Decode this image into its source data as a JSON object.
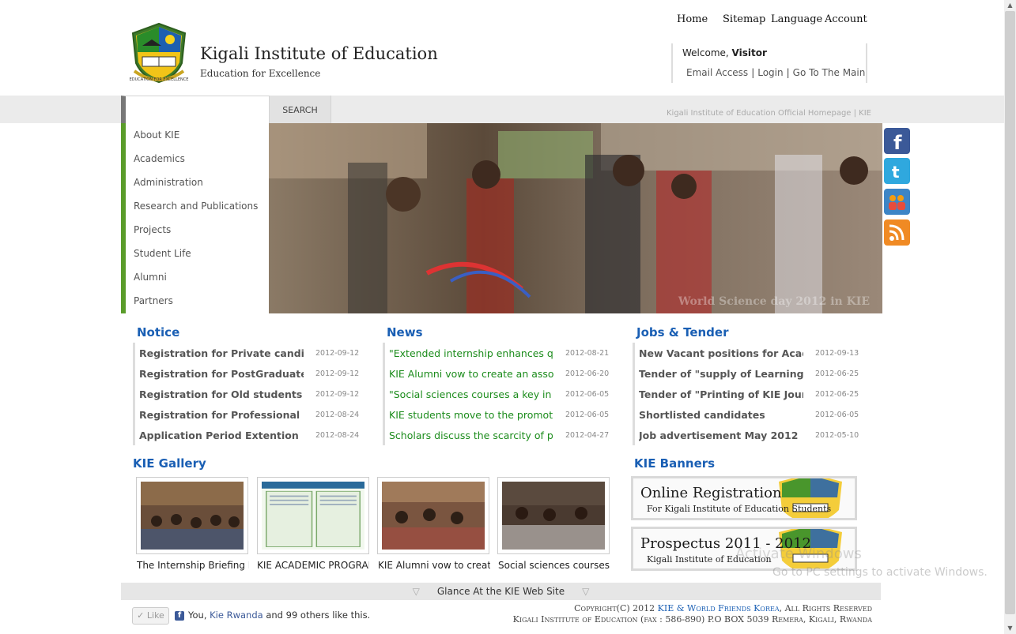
{
  "header": {
    "title": "Kigali Institute of Education",
    "tagline": "Education for Excellence",
    "logo_motto": "EDUCATION FOR EXCELLENCE"
  },
  "topnav": [
    "Home",
    "Sitemap",
    "Language",
    "Account"
  ],
  "welcome": {
    "prefix": "Welcome, ",
    "user": "Visitor",
    "links": [
      "Email Access",
      "Login",
      "Go To The Main"
    ]
  },
  "search": {
    "placeholder": "",
    "button": "SEARCH"
  },
  "breadcrumb": "Kigali Institute of Education Official Homepage | KIE",
  "leftnav": [
    "About KIE",
    "Academics",
    "Administration",
    "Research and Publications",
    "Projects",
    "Student Life",
    "Alumni",
    "Partners"
  ],
  "hero": {
    "caption": "World Science day 2012 in KIE"
  },
  "social": [
    "facebook-icon",
    "twitter-icon",
    "myspace-icon",
    "rss-icon"
  ],
  "notice": {
    "title": "Notice",
    "items": [
      {
        "title": "Registration for Private candidate",
        "date": "2012-09-12"
      },
      {
        "title": "Registration for PostGraduate & I",
        "date": "2012-09-12"
      },
      {
        "title": "Registration for Old students (Da",
        "date": "2012-09-12"
      },
      {
        "title": "Registration for Professional Polic",
        "date": "2012-08-24"
      },
      {
        "title": "Application Period Extention",
        "date": "2012-08-24"
      }
    ]
  },
  "news": {
    "title": "News",
    "items": [
      {
        "title": "\"Extended internship enhances quality",
        "date": "2012-08-21"
      },
      {
        "title": "KIE Alumni vow to create an associati",
        "date": "2012-06-20"
      },
      {
        "title": "\"Social sciences courses a key in Socia",
        "date": "2012-06-05"
      },
      {
        "title": "KIE students move to the promotion c",
        "date": "2012-06-05"
      },
      {
        "title": "Scholars discuss the scarcity of profes",
        "date": "2012-04-27"
      }
    ]
  },
  "jobs": {
    "title": "Jobs & Tender",
    "items": [
      {
        "title": "New Vacant positions for Academ",
        "date": "2012-09-13"
      },
      {
        "title": "Tender of \"supply of Learning/Te",
        "date": "2012-06-25"
      },
      {
        "title": "Tender of \"Printing of KIE Journa",
        "date": "2012-06-25"
      },
      {
        "title": "Shortlisted candidates",
        "date": "2012-06-05"
      },
      {
        "title": "Job advertisement May 2012",
        "date": "2012-05-10"
      }
    ]
  },
  "gallery": {
    "title": "KIE Gallery",
    "items": [
      {
        "caption": "The Internship Briefing Me"
      },
      {
        "caption": "KIE ACADEMIC PROGRAM"
      },
      {
        "caption": "KIE Alumni vow to create"
      },
      {
        "caption": "Social sciences courses a k"
      }
    ]
  },
  "banners": {
    "title": "KIE Banners",
    "items": [
      {
        "line1": "Online Registration",
        "line2": "For Kigali Institute of Education Students"
      },
      {
        "line1": "Prospectus 2011 - 2012",
        "line2": "Kigali Institute of Education"
      }
    ]
  },
  "glance": "Glance At the KIE Web Site",
  "like": {
    "button": "Like",
    "prefix": "You, ",
    "name": "Kie Rwanda",
    "suffix": " and 99 others like this."
  },
  "footer": {
    "prefix": "Copyright(C) 2012 ",
    "owner": "KIE & World Friends Korea",
    "suffix": ", All Rights Reserved",
    "address": "Kigali Institute of Education (fax : 586-890) P.O BOX 5039 Remera, Kigali, Rwanda"
  },
  "watermark": {
    "line1": "Activate Windows",
    "line2": "Go to PC settings to activate Windows."
  },
  "colors": {
    "accent_blue": "#1a5fb4",
    "nav_green": "#5a9c2a",
    "news_green": "#1c8c1c"
  }
}
